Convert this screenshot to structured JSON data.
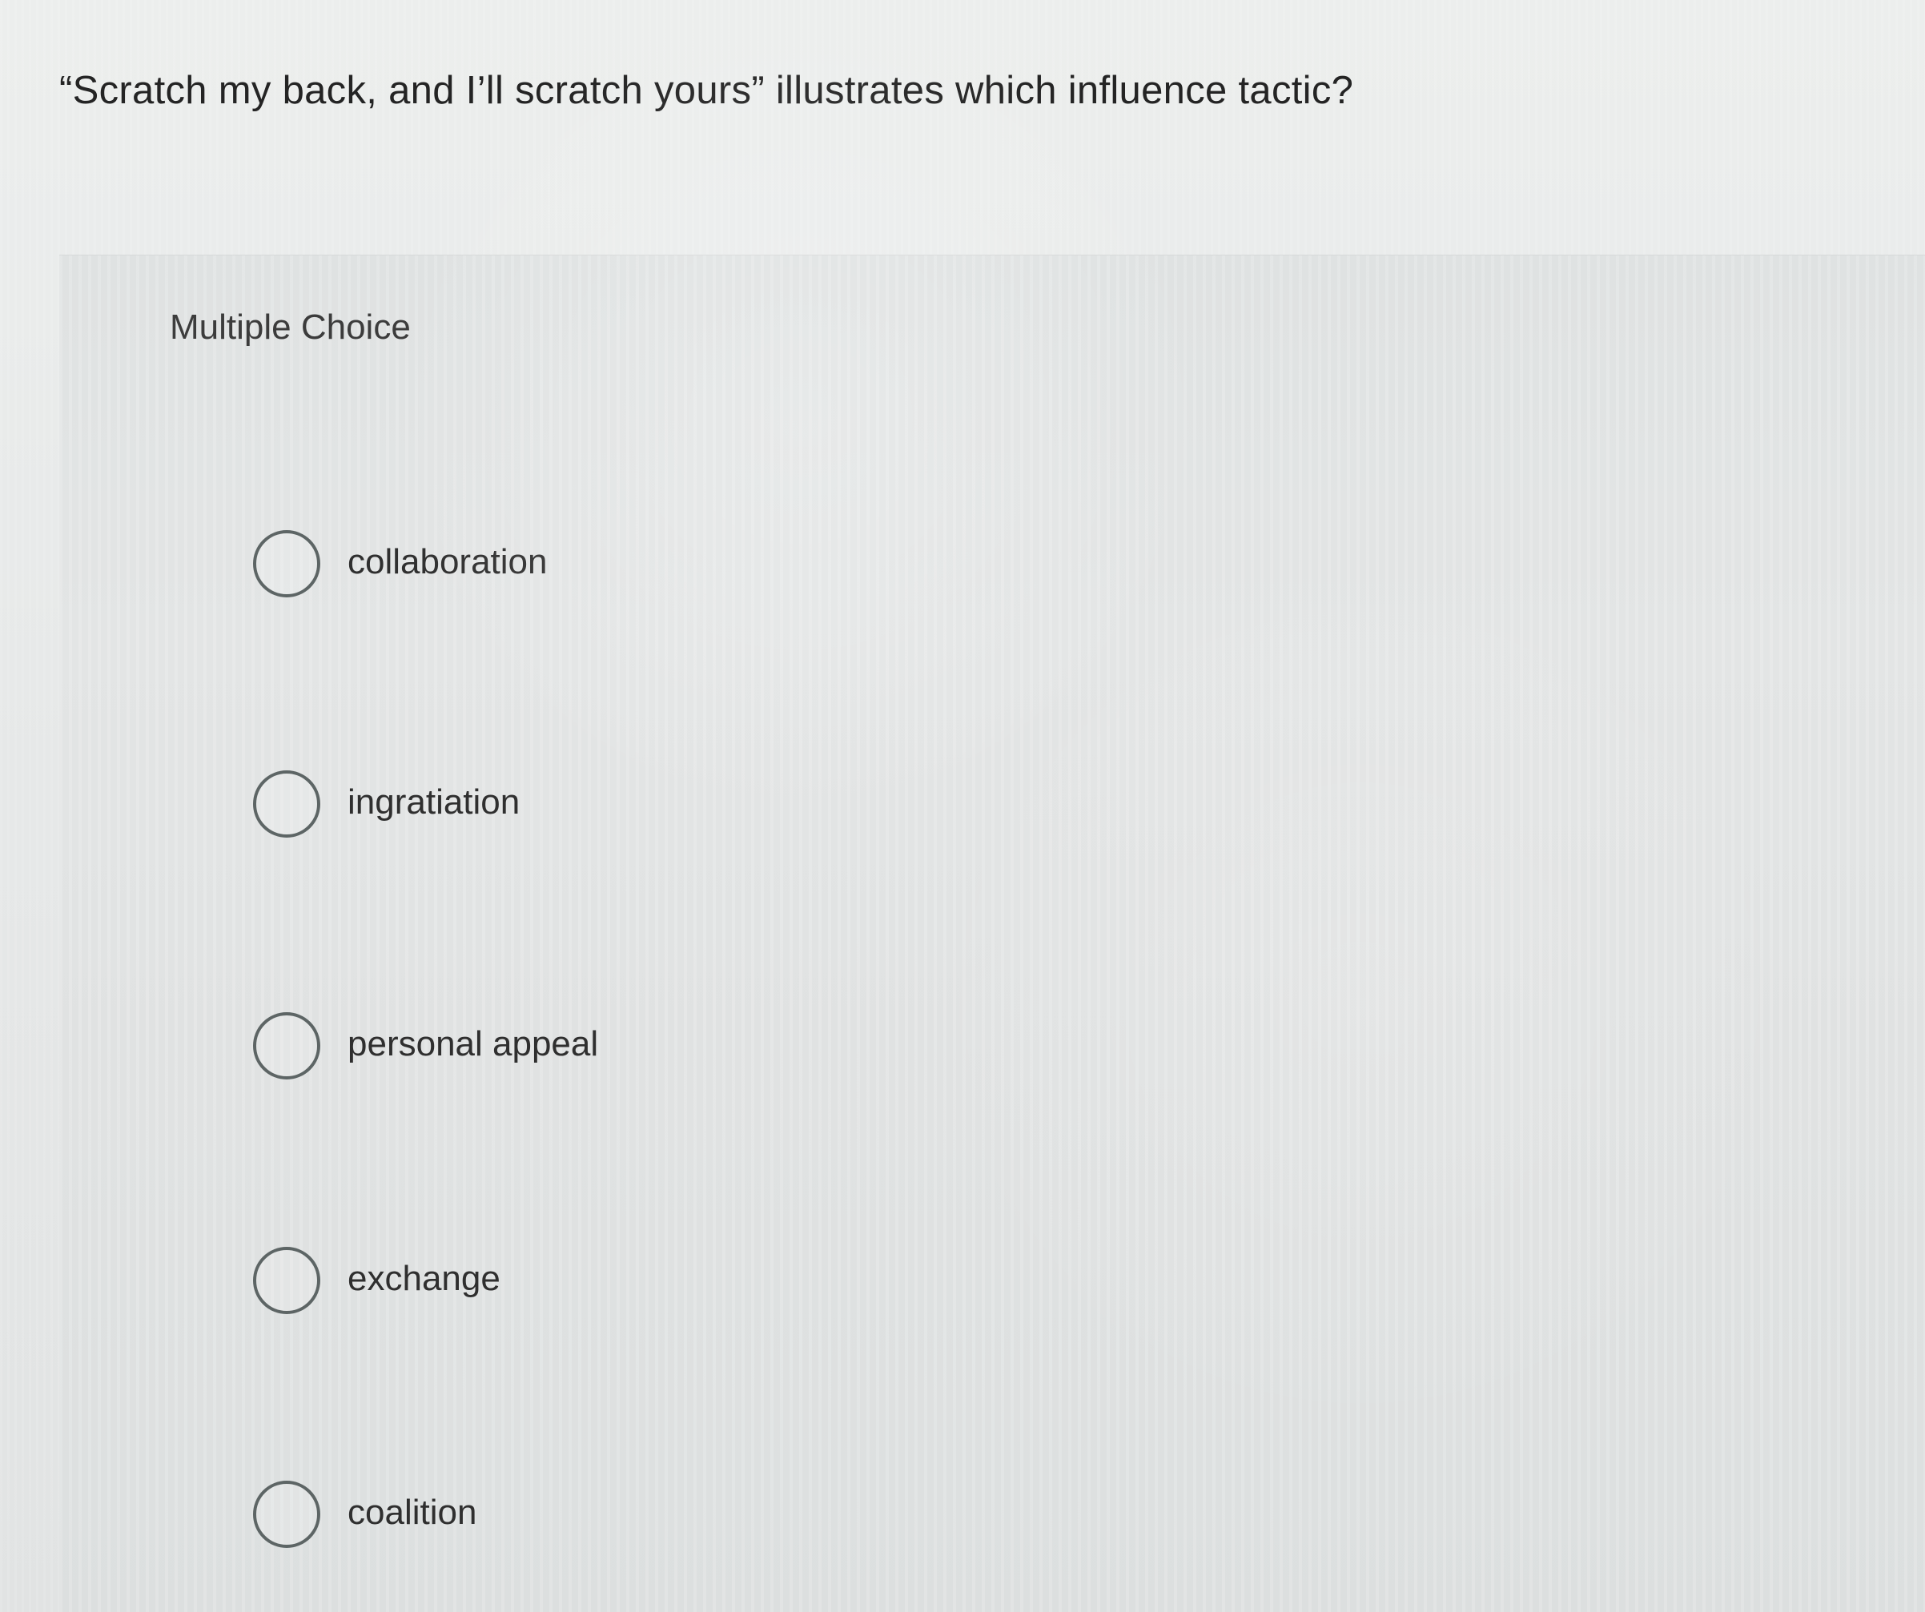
{
  "question": {
    "text": "“Scratch my back, and I’ll scratch yours” illustrates which influence tactic?"
  },
  "quiz": {
    "type_label": "Multiple Choice",
    "options": [
      {
        "label": "collaboration",
        "selected": false
      },
      {
        "label": "ingratiation",
        "selected": false
      },
      {
        "label": "personal appeal",
        "selected": false
      },
      {
        "label": "exchange",
        "selected": false
      },
      {
        "label": "coalition",
        "selected": false
      }
    ]
  },
  "colors": {
    "page_background": "#e9ebeb",
    "panel_background": "#e0e2e2",
    "text": "#2f2f2f",
    "radio_border": "#5d6565"
  }
}
